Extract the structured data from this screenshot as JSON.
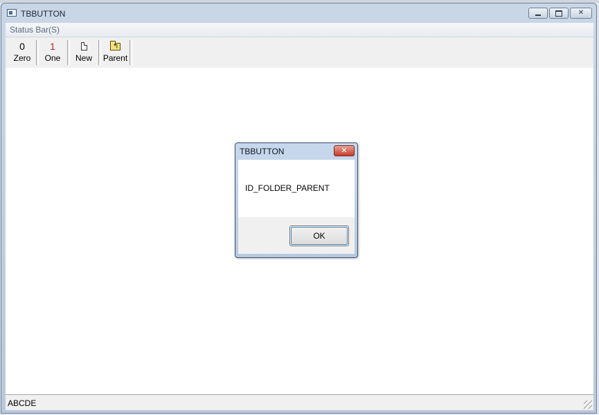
{
  "window": {
    "title": "TBBUTTON",
    "caption_buttons": {
      "minimize_icon": "minimize-icon",
      "maximize_icon": "maximize-icon",
      "close_icon": "close-icon",
      "close_label": "✕"
    }
  },
  "menu": {
    "items": [
      {
        "label": "Status Bar(S)"
      }
    ]
  },
  "toolbar": {
    "buttons": [
      {
        "glyph": "0",
        "label": "Zero"
      },
      {
        "glyph": "1",
        "label": "One",
        "glyph_color": "#c21d1d"
      },
      {
        "icon": "new-document-icon",
        "label": "New"
      },
      {
        "icon": "parent-folder-icon",
        "label": "Parent"
      }
    ]
  },
  "statusbar": {
    "text": "ABCDE"
  },
  "dialog": {
    "title": "TBBUTTON",
    "message": "ID_FOLDER_PARENT",
    "ok_label": "OK",
    "close_label": "✕"
  }
}
